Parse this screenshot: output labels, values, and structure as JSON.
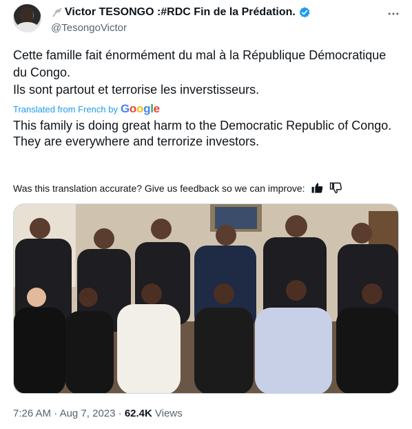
{
  "author": {
    "display_name": "Victor TESONGO :#RDC Fin de la Prédation.",
    "handle": "@TesongoVictor",
    "verified": true
  },
  "tweet": {
    "lines": [
      "Cette famille fait énormément du mal à la République Démocratique du Congo.",
      "Ils sont partout et terrorise les inverstisseurs."
    ]
  },
  "translation": {
    "label": "Translated from French by",
    "provider": "Google",
    "lines": [
      "This family is doing great harm to the Democratic Republic of Congo.",
      "They are everywhere and terrorize investors."
    ],
    "feedback_prompt": "Was this translation accurate? Give us feedback so we can improve:"
  },
  "meta": {
    "time": "7:26 AM",
    "separator": " · ",
    "date": "Aug 7, 2023",
    "views_count": "62.4K",
    "views_label": "Views"
  },
  "colors": {
    "link": "#1d9bf0",
    "secondary_text": "#536471",
    "primary_text": "#0f1419",
    "verified": "#1d9bf0"
  },
  "icons": {
    "more": "more-icon",
    "verified": "verified-badge-icon",
    "leaf": "leaf-icon",
    "thumbs_up": "thumbs-up-icon",
    "thumbs_down": "thumbs-down-icon"
  }
}
